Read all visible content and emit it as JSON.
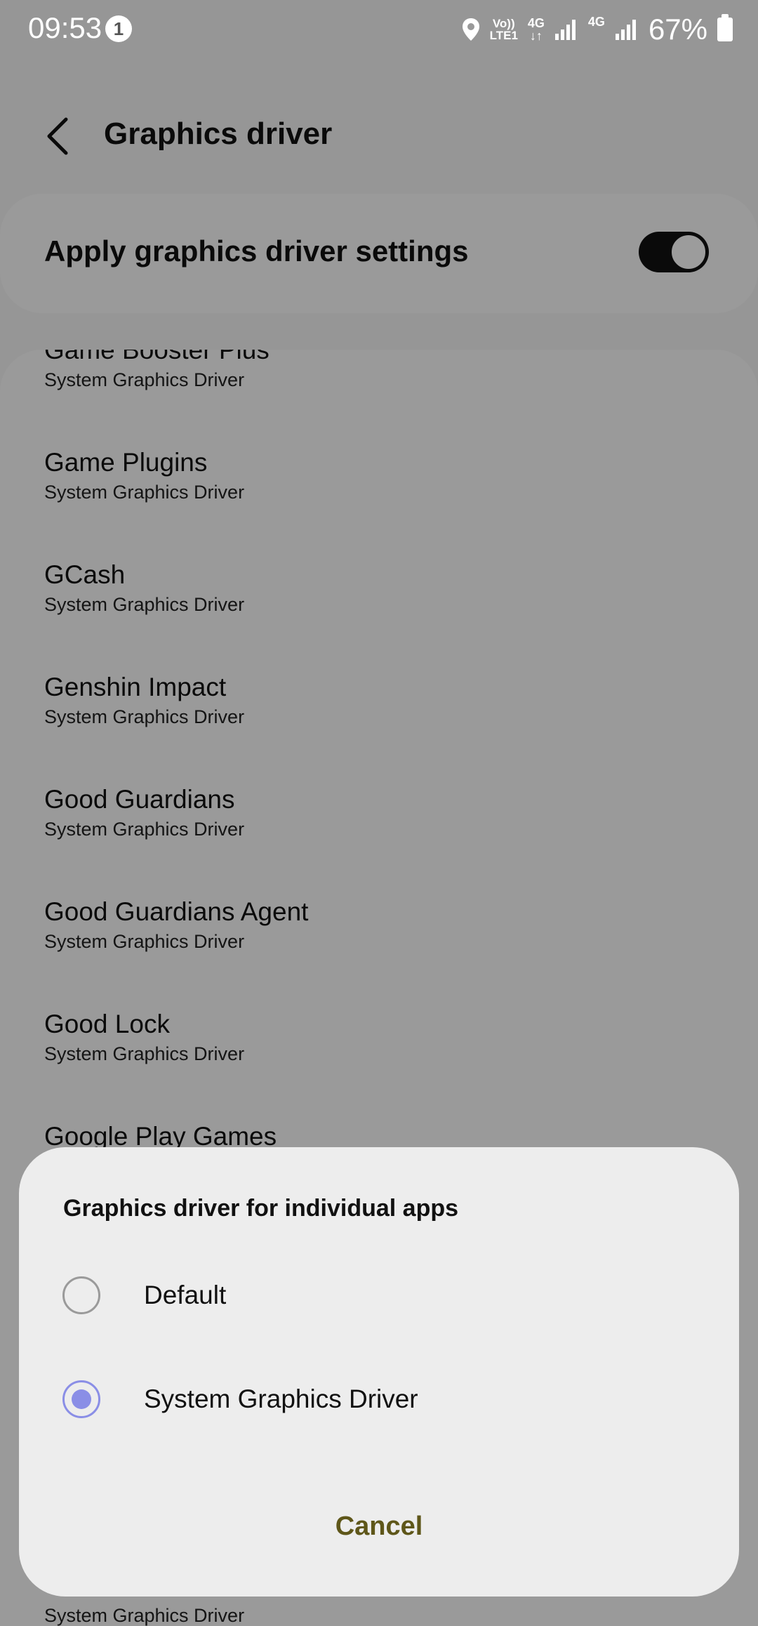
{
  "status_bar": {
    "time": "09:53",
    "notification_count": "1",
    "volte_line1": "Vo))",
    "volte_line2": "LTE1",
    "net1": "4G",
    "net2": "4G",
    "battery": "67%"
  },
  "header": {
    "title": "Graphics driver"
  },
  "master_switch": {
    "label": "Apply graphics driver settings",
    "enabled": true
  },
  "apps": [
    {
      "name": "Game Booster Plus",
      "driver": "System Graphics Driver"
    },
    {
      "name": "Game Plugins",
      "driver": "System Graphics Driver"
    },
    {
      "name": "GCash",
      "driver": "System Graphics Driver"
    },
    {
      "name": "Genshin Impact",
      "driver": "System Graphics Driver"
    },
    {
      "name": "Good Guardians",
      "driver": "System Graphics Driver"
    },
    {
      "name": "Good Guardians Agent",
      "driver": "System Graphics Driver"
    },
    {
      "name": "Good Lock",
      "driver": "System Graphics Driver"
    },
    {
      "name": "Google Play Games",
      "driver": ""
    },
    {
      "name": "",
      "driver": "System Graphics Driver"
    }
  ],
  "dialog": {
    "title": "Graphics driver for individual apps",
    "options": [
      {
        "label": "Default",
        "selected": false
      },
      {
        "label": "System Graphics Driver",
        "selected": true
      }
    ],
    "cancel_label": "Cancel"
  },
  "colors": {
    "radio_accent": "#8a8ee6",
    "cancel_text": "#5e5619",
    "toggle_on": "#111111"
  }
}
